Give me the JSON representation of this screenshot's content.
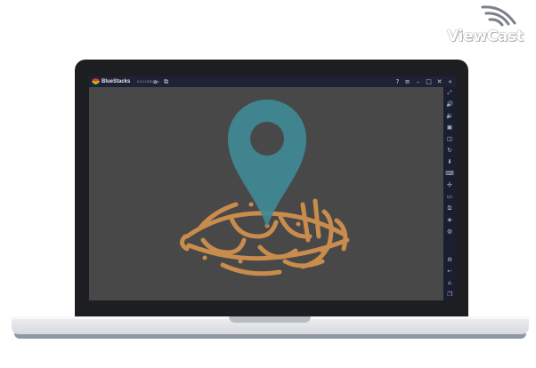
{
  "watermark": {
    "text": "ViewCast"
  },
  "window": {
    "app_name": "BlueStacks",
    "version": "5.9.0.1028 Beta"
  },
  "titlebar_icons": {
    "left": [
      "home-icon",
      "multi-instance-icon"
    ],
    "right": [
      "help-icon",
      "menu-icon",
      "minimize-icon",
      "maximize-icon",
      "close-icon",
      "collapse-sidebar-icon"
    ]
  },
  "sidebar_icons": [
    "fullscreen-icon",
    "volume-up-icon",
    "volume-down-icon",
    "media-icon",
    "screenshot-icon",
    "rotate-icon",
    "install-apk-icon",
    "keyboard-controls-icon",
    "shake-icon",
    "folder-icon",
    "multi-instance-icon",
    "layers-icon",
    "eco-mode-icon",
    "settings-icon",
    "back-icon",
    "home-icon",
    "recent-apps-icon"
  ],
  "colors": {
    "pin": "#3f8a95",
    "calligraphy": "#c98c4c",
    "app_background": "#484848",
    "titlebar": "#1f2235",
    "laptop_frame": "#1d1e22"
  }
}
